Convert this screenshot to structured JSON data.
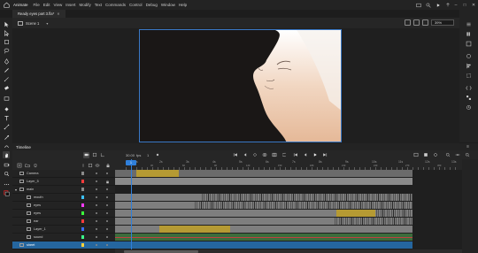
{
  "app": {
    "workspace": "Animate",
    "menus": [
      "File",
      "Edit",
      "View",
      "Insert",
      "Modify",
      "Text",
      "Commands",
      "Control",
      "Debug",
      "Window",
      "Help"
    ]
  },
  "document": {
    "tab_title": "Ready eyes part 3.fla*"
  },
  "scene": {
    "name": "Scene 1",
    "zoom": "39%"
  },
  "timeline": {
    "title": "Timeline",
    "fps": "30.00",
    "current_frame": "1",
    "ruler": [
      "1s",
      "2s",
      "3s",
      "4s",
      "5s",
      "6s",
      "7s",
      "8s",
      "9s",
      "10s",
      "11s",
      "12s",
      "13s"
    ],
    "ruler_frames": [
      "5",
      "10",
      "15",
      "20",
      "25",
      "30",
      "35",
      "40",
      "45",
      "50",
      "55",
      "60",
      "65",
      "70",
      "75",
      "80",
      "85",
      "90",
      "95",
      "100",
      "105",
      "110",
      "115",
      "120",
      "125",
      "130",
      "135",
      "140",
      "145",
      "150",
      "155",
      "160",
      "165",
      "170",
      "175",
      "180",
      "185",
      "190",
      "195",
      "200",
      "205",
      "210",
      "215",
      "220",
      "225",
      "230",
      "235",
      "240",
      "245",
      "250",
      "255",
      "260",
      "265",
      "270",
      "275",
      "280",
      "285",
      "290",
      "295",
      "300",
      "305",
      "310",
      "315",
      "320",
      "325",
      "330",
      "335",
      "340",
      "345",
      "350",
      "355",
      "360",
      "365",
      "370",
      "375",
      "380",
      "385",
      "390",
      "395"
    ],
    "layers": [
      {
        "name": "Camera",
        "color": "#8a8a8a",
        "locked": false,
        "indent": 0,
        "selected": false
      },
      {
        "name": "Layer_5",
        "color": "#ff3c3c",
        "locked": true,
        "indent": 0,
        "selected": false
      },
      {
        "name": "main",
        "color": "#8a8a8a",
        "locked": false,
        "indent": 0,
        "selected": false
      },
      {
        "name": "mouth",
        "color": "#3cc2ff",
        "locked": false,
        "indent": 1,
        "selected": false
      },
      {
        "name": "eyes",
        "color": "#ff3cff",
        "locked": false,
        "indent": 1,
        "selected": false
      },
      {
        "name": "eyes",
        "color": "#3cff3c",
        "locked": false,
        "indent": 1,
        "selected": false
      },
      {
        "name": "ear",
        "color": "#ff3c3c",
        "locked": false,
        "indent": 1,
        "selected": false
      },
      {
        "name": "Layer_1",
        "color": "#3c6cff",
        "locked": false,
        "indent": 1,
        "selected": false
      },
      {
        "name": "sound",
        "color": "#3cff8a",
        "locked": false,
        "indent": 1,
        "selected": false
      },
      {
        "name": "sheet",
        "color": "#ffd23c",
        "locked": false,
        "indent": 0,
        "selected": true
      }
    ]
  },
  "colors": {
    "accent": "#2f7fda",
    "tween": "#b59a33",
    "selected_layer": "#25669f"
  }
}
